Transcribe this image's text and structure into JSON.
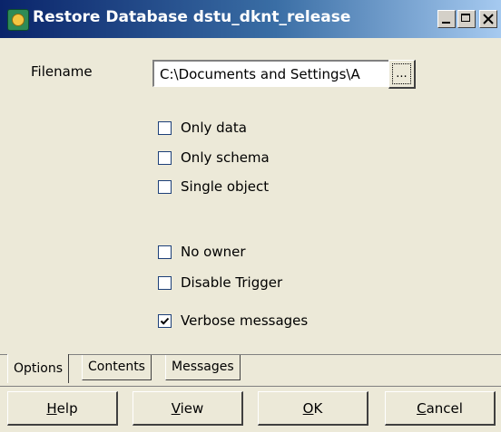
{
  "window": {
    "title": "Restore Database dstu_dknt_release"
  },
  "form": {
    "filename_label": "Filename",
    "filename_value": "C:\\Documents and Settings\\A",
    "browse_label": "..."
  },
  "options": [
    {
      "label": "Only data",
      "checked": false
    },
    {
      "label": "Only schema",
      "checked": false
    },
    {
      "label": "Single object",
      "checked": false
    },
    {
      "label": "No owner",
      "checked": false
    },
    {
      "label": "Disable Trigger",
      "checked": false
    },
    {
      "label": "Verbose messages",
      "checked": true
    }
  ],
  "tabs": [
    {
      "label": "Options",
      "active": true
    },
    {
      "label": "Contents",
      "active": false
    },
    {
      "label": "Messages",
      "active": false
    }
  ],
  "buttons": {
    "help": {
      "prefix": "",
      "mnemonic": "H",
      "suffix": "elp"
    },
    "view": {
      "prefix": "",
      "mnemonic": "V",
      "suffix": "iew"
    },
    "ok": {
      "prefix": "",
      "mnemonic": "O",
      "suffix": "K"
    },
    "cancel": {
      "prefix": "",
      "mnemonic": "C",
      "suffix": "ancel"
    }
  }
}
